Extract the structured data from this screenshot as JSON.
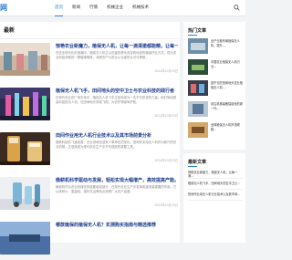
{
  "site": {
    "logo_text": "网"
  },
  "nav": {
    "items": [
      "首页",
      "新闻",
      "行情",
      "机械企业",
      "机械技术"
    ],
    "active_index": 0
  },
  "main": {
    "section_title": "最新",
    "articles": [
      {
        "title": "惊艳农业新魔力，植保无人机，让每一滴清澈都能精，让每一寸…",
        "excerpt": "在农业现代化的浪潮中，植保无人机正以迅猛的势头改变着传统的植保作业方式，成为农业科技领域的一颗璀璨明珠，深受农户与农业从业者的认可与青睐。",
        "category": "",
        "tag": "",
        "time": "2024年10月25日"
      },
      {
        "title": "植保无人机飞手，田间地头的空中卫士与农业科技的践行者",
        "excerpt": "在现代农业的广阔天地中，植保无人机飞手正逐渐成为一支不可忽视的力量。他们驾驭着高科技的无人机，在田间地头穿梭飞翔，为农作物保驾护航。",
        "category": "",
        "tag": "",
        "time": "2024年10月25日"
      },
      {
        "title": "田间作业用无人机行业技术以及其市场前景分析",
        "excerpt": "随着科技的飞速发展，农业领域也迎来了革命性的变化。田间作业用无人机作为新兴的农业机械，正逐渐成为现代农业生产中不可或缺的重要工具。",
        "category": "",
        "tag": "",
        "time": "2024年10月25日"
      },
      {
        "title": "微耕机科学驱动与发展，轻松实现大幅增产，高效提高产能。",
        "excerpt": "微耕机作为农业机械化的重要组成部分，在现代农业生产中发挥着越来越重要的作用。它以体积小、重量轻、操作灵活等特点深受广大农户喜爱。",
        "category": "",
        "tag": "",
        "time": "2024年10月25日"
      },
      {
        "title": "哪款植保的植保无人机？实测购买指南与精选推荐",
        "excerpt": "",
        "category": "",
        "tag": "",
        "time": ""
      }
    ]
  },
  "sidebar": {
    "hot_title": "热门文章",
    "hot_items": [
      "全产业链布局植保无人机，提升…",
      "中国农业植保无人机行业…",
      "回不去的田间地头农业植保无人机…",
      "前沿机械装备智能化的新一代…",
      "全球植保无人机市场规模…",
      "农业植保无人机作业面积…",
      "全面解析农业无人机的…"
    ],
    "new_title": "最新文章",
    "new_items": [
      "惊艳农业新魔力，植保无人机，让每一滴…",
      "植保无人机飞手，田间地头的空中卫士…",
      "田间作业用无人机行业技术以及其市场…"
    ]
  },
  "colors": {
    "accent": "#2b7bd6",
    "title_blue": "#1d3c8f"
  }
}
